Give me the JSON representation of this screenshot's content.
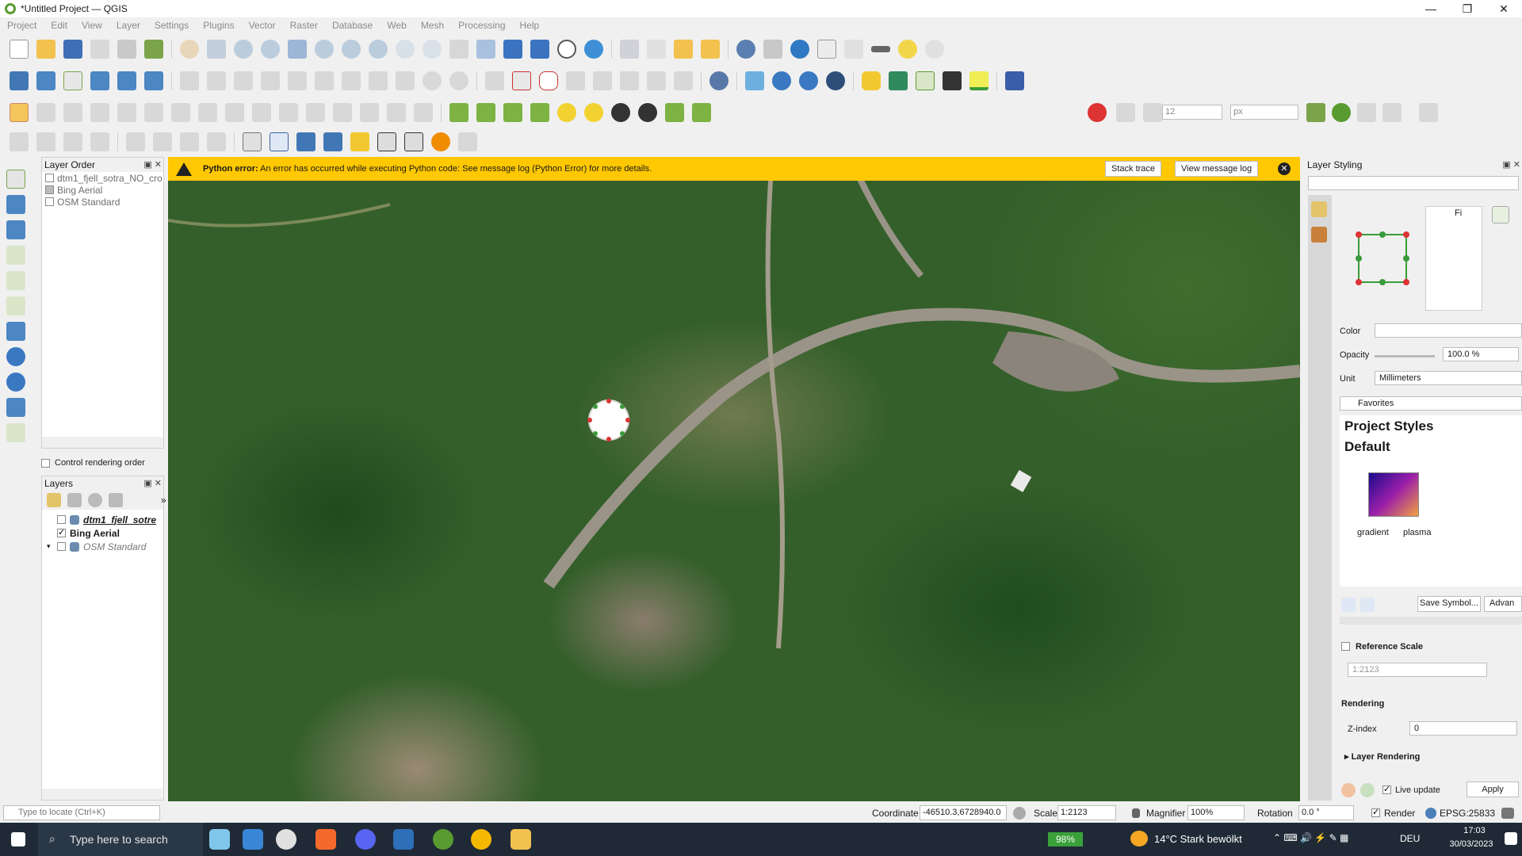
{
  "window": {
    "title": "*Untitled Project — QGIS",
    "controls": [
      "—",
      "❐",
      "✕"
    ]
  },
  "menu": [
    "Project",
    "Edit",
    "View",
    "Layer",
    "Settings",
    "Plugins",
    "Vector",
    "Raster",
    "Database",
    "Web",
    "Mesh",
    "Processing",
    "Help"
  ],
  "toolbar": {
    "snap_tolerance": "12",
    "snap_units": "px"
  },
  "layer_order": {
    "title": "Layer Order",
    "items": [
      "dtm1_fjell_sotra_NO_cro",
      "Bing Aerial",
      "OSM Standard"
    ],
    "control_rendering_label": "Control rendering order"
  },
  "layers": {
    "title": "Layers",
    "items": [
      {
        "name": "dtm1_fjell_sotre",
        "checked": false
      },
      {
        "name": "Bing Aerial",
        "checked": true
      },
      {
        "name": "OSM Standard",
        "checked": false
      }
    ]
  },
  "error": {
    "label": "Python error:",
    "message": "An error has occurred while executing Python code: See message log (Python Error) for more details.",
    "stack_trace": "Stack trace",
    "view_log": "View message log"
  },
  "styling": {
    "title": "Layer Styling",
    "symbol_type": "Fi",
    "color_label": "Color",
    "opacity_label": "Opacity",
    "opacity_value": "100.0 %",
    "unit_label": "Unit",
    "unit_value": "Millimeters",
    "search_value": "Favorites",
    "project_styles": "Project Styles",
    "default": "Default",
    "ramp_labels": [
      "gradient",
      "plasma"
    ],
    "save_symbol": "Save Symbol...",
    "advanced": "Advan",
    "reference_scale_label": "Reference Scale",
    "reference_scale_value": "1:2123",
    "rendering_label": "Rendering",
    "zindex_label": "Z-index",
    "zindex_value": "0",
    "layer_rendering_label": "Layer Rendering",
    "live_update_label": "Live update",
    "apply": "Apply"
  },
  "statusbar": {
    "locate_placeholder": "Type to locate (Ctrl+K)",
    "coordinate_label": "Coordinate",
    "coordinate_value": "-46510.3,6728940.0",
    "scale_label": "Scale",
    "scale_value": "1:2123",
    "magnifier_label": "Magnifier",
    "magnifier_value": "100%",
    "rotation_label": "Rotation",
    "rotation_value": "0.0 °",
    "render_label": "Render",
    "crs": "EPSG:25833"
  },
  "taskbar": {
    "search_placeholder": "Type here to search",
    "battery": "98%",
    "weather": "14°C  Stark bewölkt",
    "language": "DEU",
    "time": "17:03",
    "date": "30/03/2023"
  },
  "colors": {
    "error_banner": "#ffc800",
    "taskbar": "#1f2a36",
    "qgis_green": "#5a9b31"
  }
}
